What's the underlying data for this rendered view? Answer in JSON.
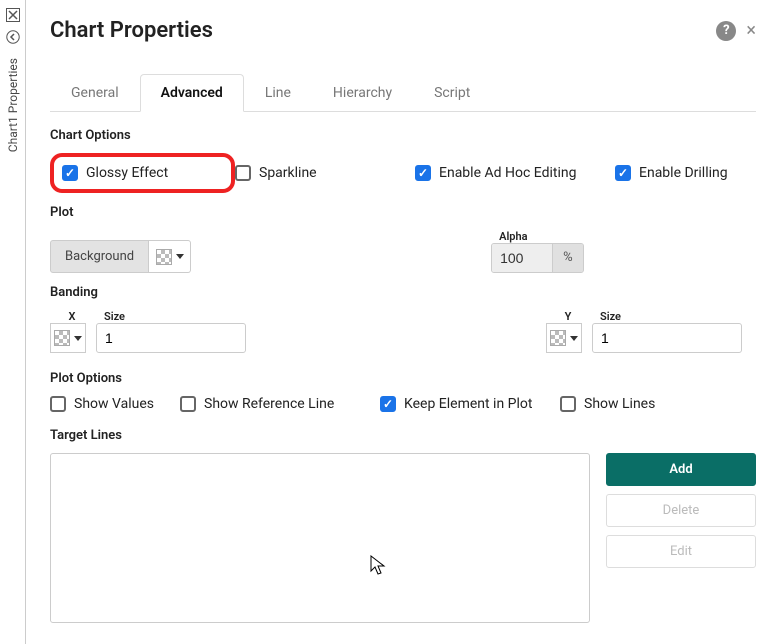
{
  "rail": {
    "label": "Chart1 Properties"
  },
  "header": {
    "title": "Chart Properties"
  },
  "tabs": [
    "General",
    "Advanced",
    "Line",
    "Hierarchy",
    "Script"
  ],
  "activeTabIndex": 1,
  "sections": {
    "chart_options": {
      "label": "Chart Options",
      "items": {
        "glossy": {
          "label": "Glossy Effect",
          "checked": true
        },
        "sparkline": {
          "label": "Sparkline",
          "checked": false
        },
        "adhoc": {
          "label": "Enable Ad Hoc Editing",
          "checked": true
        },
        "drilling": {
          "label": "Enable Drilling",
          "checked": true
        }
      }
    },
    "plot": {
      "label": "Plot",
      "background_btn": "Background",
      "alpha": {
        "label": "Alpha",
        "value": "100",
        "addon": "%"
      }
    },
    "banding": {
      "label": "Banding",
      "x": {
        "label": "X",
        "size_label": "Size",
        "size_value": "1"
      },
      "y": {
        "label": "Y",
        "size_label": "Size",
        "size_value": "1"
      }
    },
    "plot_options": {
      "label": "Plot Options",
      "items": {
        "show_values": {
          "label": "Show Values",
          "checked": false
        },
        "ref_line": {
          "label": "Show Reference Line",
          "checked": false
        },
        "keep_elem": {
          "label": "Keep Element in Plot",
          "checked": true
        },
        "show_lines": {
          "label": "Show Lines",
          "checked": false
        }
      }
    },
    "target_lines": {
      "label": "Target Lines",
      "buttons": {
        "add": "Add",
        "delete": "Delete",
        "edit": "Edit"
      }
    }
  }
}
